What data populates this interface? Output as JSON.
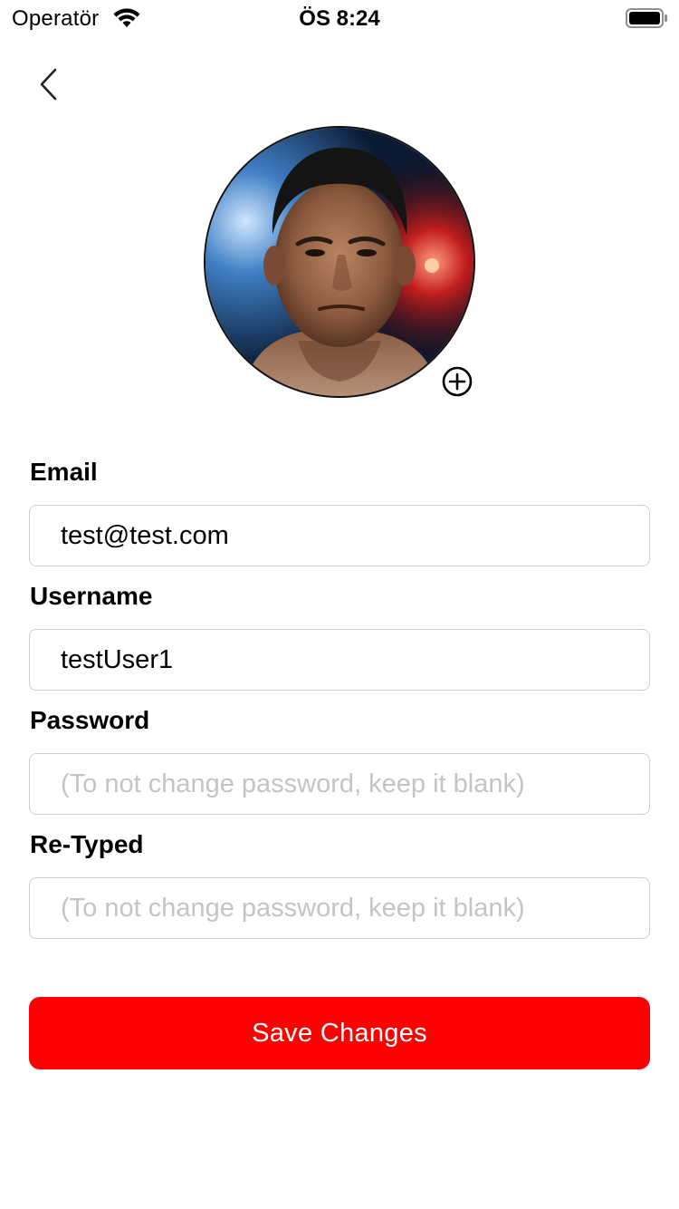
{
  "status_bar": {
    "carrier": "Operatör",
    "time": "ÖS 8:24",
    "wifi_icon": "wifi-icon",
    "battery_icon": "battery-icon"
  },
  "nav": {
    "back_icon": "chevron-left-icon"
  },
  "profile": {
    "avatar_icon": "avatar-photo",
    "add_photo_icon": "plus-circle-icon"
  },
  "form": {
    "email": {
      "label": "Email",
      "value": "test@test.com",
      "placeholder": ""
    },
    "username": {
      "label": "Username",
      "value": "testUser1",
      "placeholder": ""
    },
    "password": {
      "label": "Password",
      "value": "",
      "placeholder": "(To not change password, keep it blank)"
    },
    "retyped": {
      "label": "Re-Typed",
      "value": "",
      "placeholder": "(To not change password, keep it blank)"
    }
  },
  "actions": {
    "save_label": "Save Changes"
  },
  "colors": {
    "accent": "#ff0000",
    "input_border": "#cfcfcf",
    "placeholder": "#c4c4c8"
  }
}
